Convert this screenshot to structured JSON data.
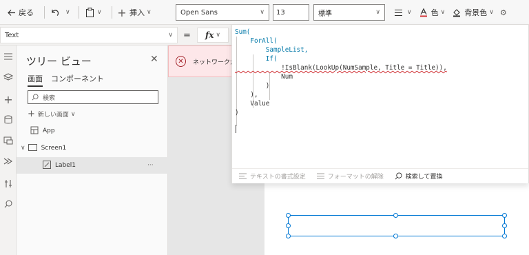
{
  "toolbar": {
    "back_label": "戻る",
    "insert_label": "挿入",
    "font": "Open Sans",
    "font_size": "13",
    "font_weight": "標準",
    "color_label": "色",
    "background_label": "背景色"
  },
  "formula_bar": {
    "property": "Text",
    "equals": "=",
    "fx": "fx"
  },
  "tree_view": {
    "title": "ツリー ビュー",
    "tabs": [
      "画面",
      "コンポーネント"
    ],
    "search_placeholder": "検索",
    "new_screen": "新しい画面",
    "items": [
      {
        "label": "App"
      },
      {
        "label": "Screen1"
      },
      {
        "label": "Label1"
      }
    ]
  },
  "notification": {
    "text": "ネットワークが"
  },
  "formula_editor": {
    "lines": [
      "Sum(",
      "    ForAll(",
      "        SampleList,",
      "        If(",
      "            !IsBlank(LookUp(NumSample, Title = Title)),",
      "            Num",
      "        )",
      "    ),",
      "    Value",
      ")"
    ],
    "footer": {
      "format_text": "テキストの書式設定",
      "remove_format": "フォーマットの解除",
      "find_replace": "検索して置換"
    }
  },
  "icons": {
    "back": "back-arrow-icon",
    "undo": "undo-icon",
    "paste": "paste-icon",
    "insert": "plus-icon",
    "align": "align-icon",
    "font_color": "font-color-icon",
    "fill": "fill-icon",
    "settings": "gear-icon"
  },
  "colors": {
    "accent": "#0078d4",
    "error": "#a4262c",
    "keyword": "#0078a8"
  }
}
